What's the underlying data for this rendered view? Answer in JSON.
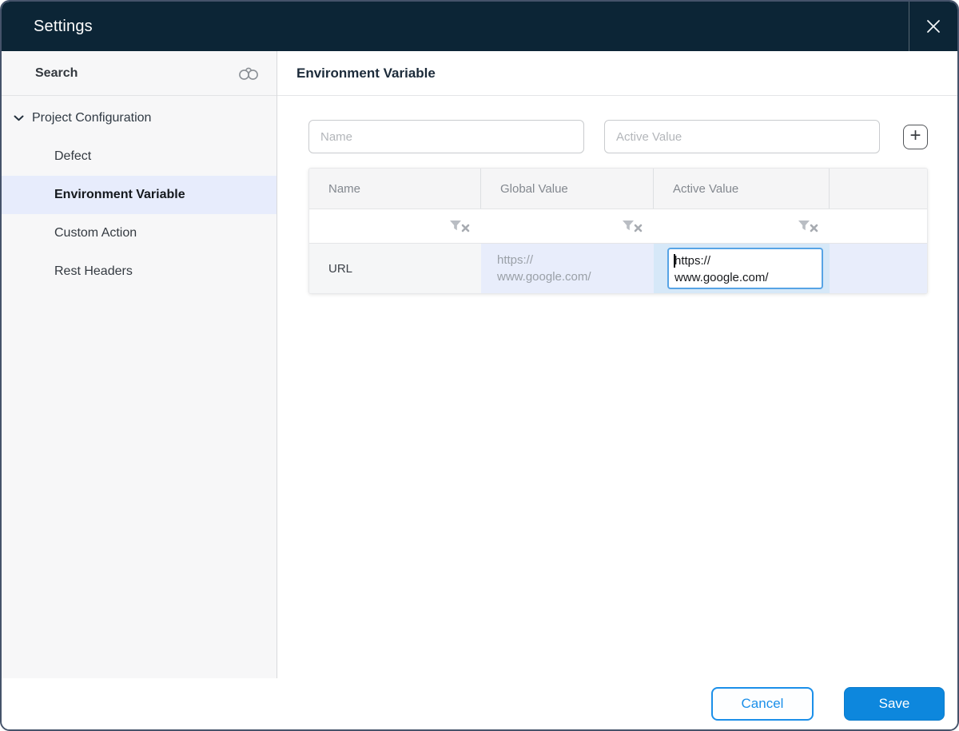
{
  "window": {
    "title": "Settings"
  },
  "sidebar": {
    "search_label": "Search",
    "tree": {
      "root_label": "Project Configuration",
      "items": [
        {
          "label": "Defect",
          "selected": false
        },
        {
          "label": "Environment Variable",
          "selected": true
        },
        {
          "label": "Custom Action",
          "selected": false
        },
        {
          "label": "Rest Headers",
          "selected": false
        }
      ]
    }
  },
  "main": {
    "heading": "Environment Variable",
    "form": {
      "name_placeholder": "Name",
      "active_value_placeholder": "Active Value",
      "add_button_label": "+"
    },
    "table": {
      "columns": [
        "Name",
        "Global Value",
        "Active Value",
        ""
      ],
      "rows": [
        {
          "name": "URL",
          "global_value": "https://www.google.com/",
          "global_value_lines": [
            "https://",
            "www.google.com/"
          ],
          "active_value": "https://www.google.com/",
          "active_value_lines": [
            "https://",
            "www.google.com/"
          ]
        }
      ]
    }
  },
  "footer": {
    "cancel_label": "Cancel",
    "save_label": "Save"
  },
  "colors": {
    "titlebar_bg": "#0c2536",
    "accent_blue": "#0d87dd",
    "cancel_blue": "#1b8fe9",
    "selected_item_bg": "#e7ecfc",
    "row_highlight_bg": "#e8edfb",
    "active_cell_bg": "#d6e8f8",
    "focused_input_border": "#57a4e5"
  }
}
